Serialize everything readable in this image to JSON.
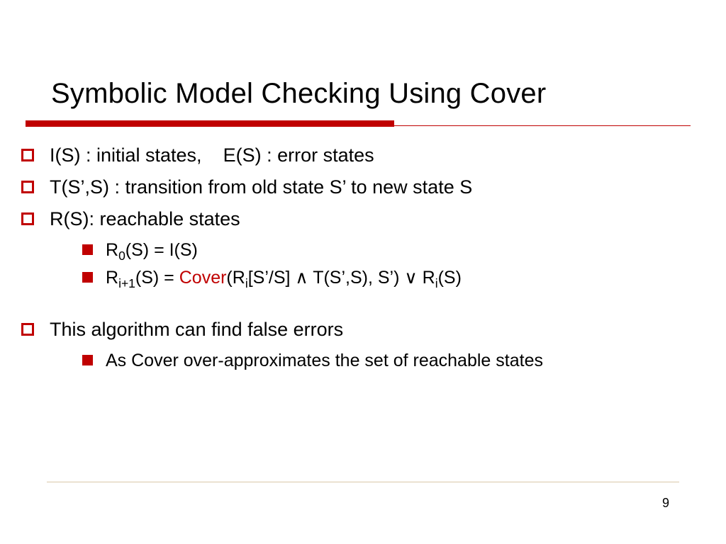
{
  "title": "Symbolic Model Checking Using Cover",
  "bullets": {
    "b1": "I(S) : initial states,    E(S) : error states",
    "b2": "T(S’,S) : transition from old state S’ to new state S",
    "b3": "R(S): reachable states",
    "b4": "This algorithm can find false errors",
    "s1_pre": "R",
    "s1_sub": "0",
    "s1_post": "(S) = I(S)",
    "s2_pre": "R",
    "s2_sub1": "i+1",
    "s2_mid1": "(S) = ",
    "s2_cover": "Cover",
    "s2_mid2": "(R",
    "s2_sub2": "i",
    "s2_mid3": "[S’/S] ",
    "s2_and": "∧",
    "s2_mid4": " T(S’,S), S’) ",
    "s2_or": "∨",
    "s2_mid5": " R",
    "s2_sub3": "i",
    "s2_post": "(S)",
    "s3": "As Cover over-approximates the set of reachable states"
  },
  "page": "9"
}
